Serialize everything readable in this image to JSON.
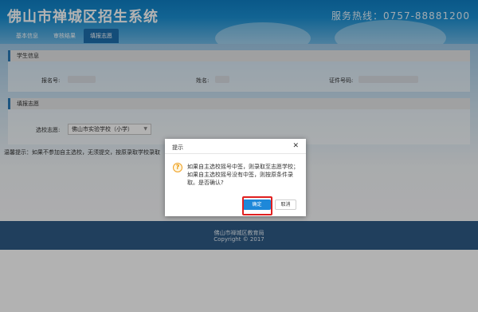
{
  "header": {
    "site_title": "佛山市禅城区招生系统",
    "hotline": "服务热线：0757-88881200"
  },
  "nav": {
    "items": [
      {
        "label": "基本信息"
      },
      {
        "label": "审核结果"
      },
      {
        "label": "填报志愿"
      }
    ],
    "active_index": 2
  },
  "student_info": {
    "section_title": "学生信息",
    "reg_no_label": "报名号:",
    "name_label": "姓名:",
    "id_no_label": "证件号码:"
  },
  "volunteer": {
    "section_title": "填报志愿",
    "school_label": "选校志愿:",
    "school_selected": "佛山市实验学校（小学）",
    "tip": "温馨提示：如果不参加自主选校，无须提交，按原录取学校录取"
  },
  "footer": {
    "org": "佛山市禅城区教育局",
    "copyright": "Copyright © 2017"
  },
  "dialog": {
    "title": "提示",
    "message": "如果自主选校摇号中签，则录取至志愿学校；如果自主选校摇号没有中签，则按原条件录取。是否确认?",
    "confirm_label": "确定",
    "cancel_label": "取消"
  },
  "colors": {
    "header": "#1a8fd2",
    "footer": "#2e5b86",
    "confirm": "#1e88d9",
    "highlight": "#e02020"
  }
}
